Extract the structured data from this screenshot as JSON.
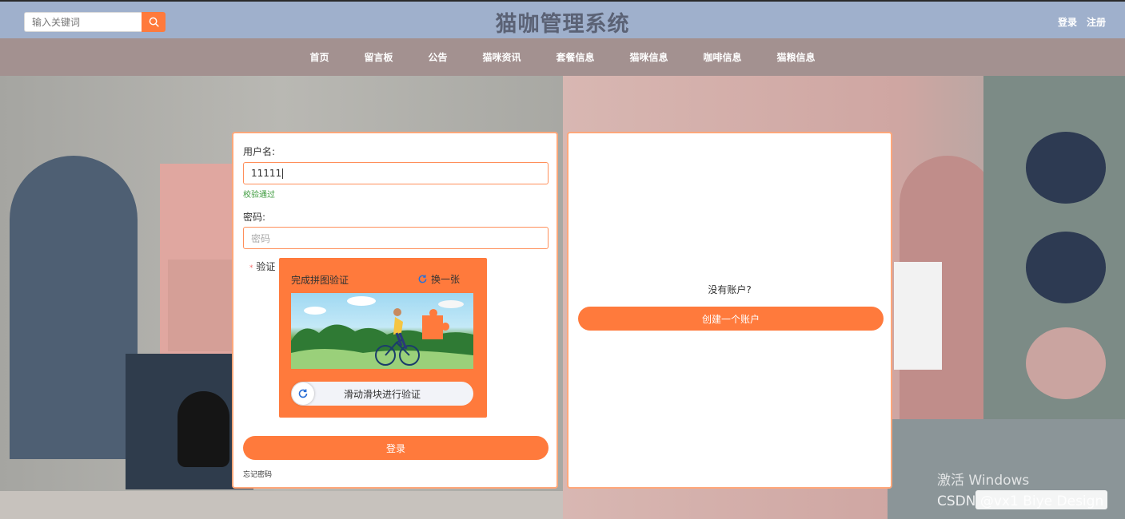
{
  "header": {
    "search_placeholder": "输入关键词",
    "title": "猫咖管理系统",
    "login_link": "登录",
    "register_link": "注册"
  },
  "nav": {
    "items": [
      "首页",
      "留言板",
      "公告",
      "猫咪资讯",
      "套餐信息",
      "猫咪信息",
      "咖啡信息",
      "猫粮信息"
    ]
  },
  "login_form": {
    "username_label": "用户名:",
    "username_value": "11111",
    "validation_message": "校验通过",
    "password_label": "密码:",
    "password_placeholder": "密码",
    "verify_required_mark": "*",
    "verify_label": "验证",
    "captcha": {
      "title": "完成拼图验证",
      "refresh_label": "换一张",
      "slider_text": "滑动滑块进行验证"
    },
    "submit_label": "登录",
    "forgot_label": "忘记密码"
  },
  "signup_panel": {
    "prompt": "没有账户?",
    "button_label": "创建一个账户"
  },
  "watermark": {
    "activate_text": "激活 Windows",
    "csdn_text": "CSDN @vx1 Biye Design"
  },
  "colors": {
    "accent": "#ff7a3c",
    "header_bg": "#9fb0cc",
    "nav_bg": "#a39190",
    "success": "#3c9a3c"
  }
}
